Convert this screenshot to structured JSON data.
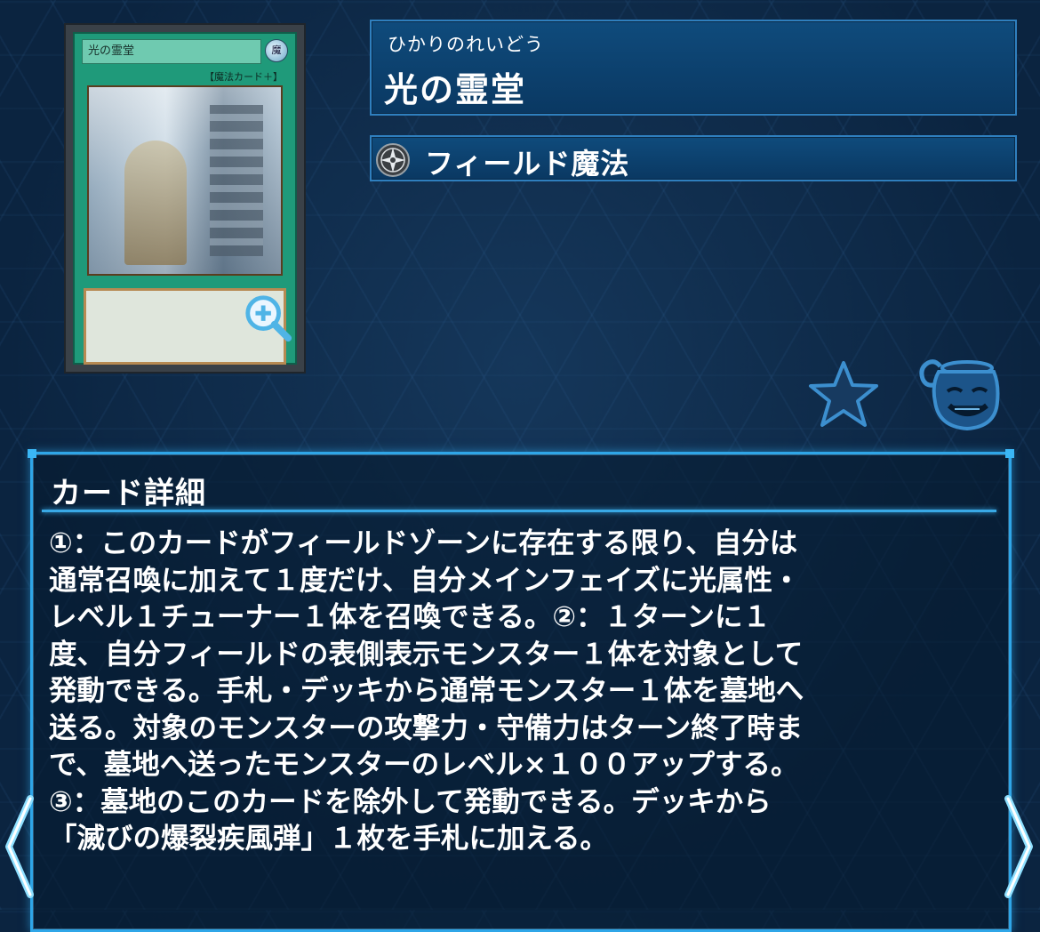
{
  "card": {
    "art_name": "光の霊堂",
    "art_attribute": "魔",
    "art_type_line": "【魔法カード＋】",
    "zoom_icon": "magnifier-plus-icon"
  },
  "header": {
    "ruby": "ひかりのれいどう",
    "name": "光の霊堂"
  },
  "type": {
    "icon": "field-spell-icon",
    "label": "フィールド魔法"
  },
  "actions": {
    "favorite_icon": "star-icon",
    "pot_icon": "pot-of-greed-icon"
  },
  "detail": {
    "title": "カード詳細",
    "text": "①：このカードがフィールドゾーンに存在する限り、自分は\n通常召喚に加えて１度だけ、自分メインフェイズに光属性・\nレベル１チューナー１体を召喚できる。②：１ターンに１\n度、自分フィールドの表側表示モンスター１体を対象として\n発動できる。手札・デッキから通常モンスター１体を墓地へ\n送る。対象のモンスターの攻撃力・守備力はターン終了時ま\nで、墓地へ送ったモンスターのレベル×１００アップする。\n③：墓地のこのカードを除外して発動できる。デッキから\n「滅びの爆裂疾風弾」１枚を手札に加える。"
  },
  "nav": {
    "prev_icon": "chevron-left-icon",
    "next_icon": "chevron-right-icon"
  },
  "colors": {
    "accent": "#2fa6e8",
    "panel": "#0f4b7c",
    "spell_green": "#1f9a7a"
  }
}
